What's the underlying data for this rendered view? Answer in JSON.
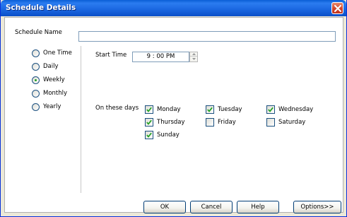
{
  "window": {
    "title": "Schedule Details"
  },
  "schedule_name": {
    "label": "Schedule Name",
    "value": ""
  },
  "frequency": {
    "selected": "Weekly",
    "options": [
      "One Time",
      "Daily",
      "Weekly",
      "Monthly",
      "Yearly"
    ]
  },
  "start_time": {
    "label": "Start Time",
    "value": "9 : 00 PM"
  },
  "days": {
    "label": "On these days",
    "items": [
      {
        "label": "Monday",
        "checked": true
      },
      {
        "label": "Tuesday",
        "checked": true
      },
      {
        "label": "Wednesday",
        "checked": true
      },
      {
        "label": "Thursday",
        "checked": true
      },
      {
        "label": "Friday",
        "checked": false
      },
      {
        "label": "Saturday",
        "checked": false
      },
      {
        "label": "Sunday",
        "checked": true
      }
    ]
  },
  "buttons": {
    "ok": "OK",
    "cancel": "Cancel",
    "help": "Help",
    "options": "Options>>"
  }
}
